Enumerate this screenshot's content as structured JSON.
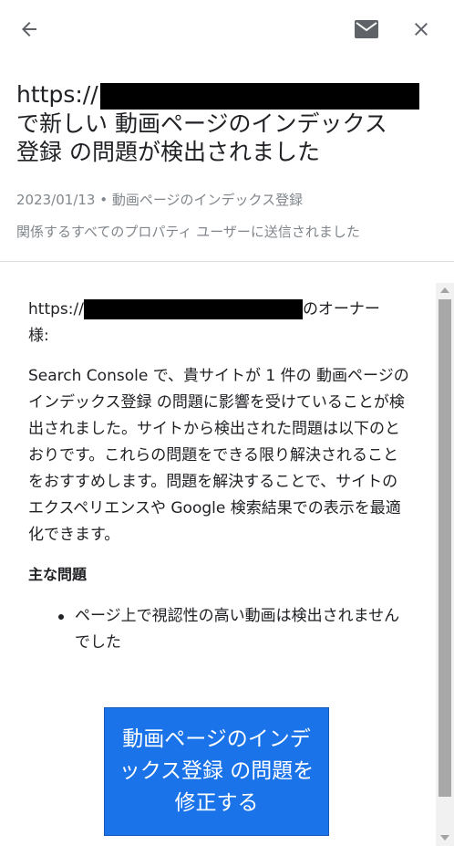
{
  "header": {
    "url_prefix": "https://",
    "title_line2": "で新しい 動画ページのインデックス",
    "title_line3": "登録 の問題が検出されました",
    "meta_line1": "2023/01/13 • 動画ページのインデックス登録",
    "meta_line2": "関係するすべてのプロパティ ユーザーに送信されました"
  },
  "toolbar": {
    "back_icon": "arrow-left-icon",
    "mail_icon": "mail-icon",
    "close_icon": "close-icon"
  },
  "body": {
    "greeting_prefix": "https://",
    "greeting_suffix": "のオーナー",
    "greeting_line2": "様:",
    "paragraph": "Search Console で、貴サイトが 1 件の 動画ページのインデックス登録 の問題に影響を受けていることが検出されました。サイトから検出された問題は以下のとおりです。これらの問題をできる限り解決されることをおすすめします。問題を解決することで、サイトのエクスペリエンスや Google 検索結果での表示を最適化できます。",
    "main_issues_heading": "主な問題",
    "issues": [
      "ページ上で視認性の高い動画は検出されませんでした"
    ],
    "cta_label": "動画ページのインデックス登録 の問題を修正する"
  },
  "colors": {
    "cta_background": "#1a73e8",
    "meta_text": "#80868b",
    "divider": "#dadce0"
  }
}
